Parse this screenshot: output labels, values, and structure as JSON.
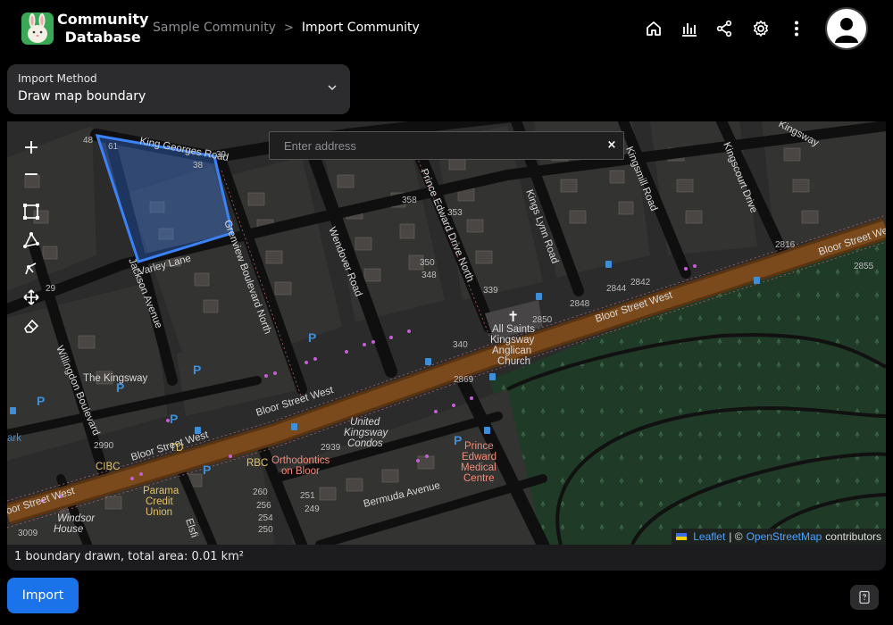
{
  "app": {
    "name_line1": "Community",
    "name_line2": "Database"
  },
  "breadcrumb": {
    "parent": "Sample Community",
    "separator": ">",
    "current": "Import Community"
  },
  "header_icons": [
    "home-icon",
    "chart-icon",
    "share-icon",
    "settings-icon",
    "more-vert-icon"
  ],
  "import_method": {
    "label": "Import Method",
    "value": "Draw map boundary"
  },
  "map": {
    "search_placeholder": "Enter address",
    "clear": "×",
    "zoom_in": "+",
    "zoom_out": "−",
    "tools": [
      "draw-rectangle-icon",
      "draw-polygon-icon",
      "edit-shape-icon",
      "drag-icon",
      "erase-icon"
    ],
    "attribution": {
      "leaflet": "Leaflet",
      "sep": " | © ",
      "osm": "OpenStreetMap",
      "suffix": " contributors"
    },
    "labels": {
      "king_georges": "King Georges Road",
      "bloor_1": "Bloor Street West",
      "bloor_2": "Bloor Street West",
      "bloor_3": "Bloor Street West",
      "bloor_4": "Bloor Street West",
      "bloor_5": "oor Street West",
      "pedw": "Prince Edward Drive North",
      "kingsway": "The Kingsway",
      "kingsway_top": "Kingsway",
      "jackson": "Jackson Avenue",
      "wendover": "Wendover Road",
      "kingsmill": "Kingsmill Road",
      "kings_lynn": "Kings Lynn Road",
      "kingscourt": "Kingscourt Drive",
      "willingdon": "Willingdon Boulevard",
      "varley": "Varley Lane",
      "grenview": "Grenview Boulevard North",
      "bermuda": "Bermuda Avenue",
      "elsfield": "Elsfi",
      "church_1": "All Saints",
      "church_2": "Kingsway",
      "church_3": "Anglican",
      "church_4": "Church",
      "ucc_1": "United",
      "ucc_2": "Kingsway",
      "ucc_3": "Condos",
      "ortho_1": "Orthodontics",
      "ortho_2": "on Bloor",
      "pemc_1": "Prince",
      "pemc_2": "Edward",
      "pemc_3": "Medical",
      "pemc_4": "Centre",
      "td": "TD",
      "rbc": "RBC",
      "cibc": "CIBC",
      "parama_1": "Parama",
      "parama_2": "Credit",
      "parama_3": "Union",
      "windsor_1": "Windsor",
      "windsor_2": "House",
      "ark": "ark",
      "n2850": "2850",
      "n2848": "2848",
      "n2844": "2844",
      "n2842": "2842",
      "n2855": "2855",
      "n2816": "2816",
      "n2869": "2869",
      "n2990": "2990",
      "n2939": "2939",
      "n3009": "3009",
      "n339": "339",
      "n340": "340",
      "n348": "348",
      "n350": "350",
      "n353": "353",
      "n358": "358",
      "n38": "38",
      "n39": "39",
      "n61": "61",
      "n48": "48",
      "n29": "29",
      "n260": "260",
      "n256": "256",
      "n254": "254",
      "n251": "251",
      "n250": "250",
      "n249": "249"
    }
  },
  "status_text": "1 boundary drawn, total area: 0.01 km²",
  "import_button": "Import",
  "colors": {
    "accent": "#1a73e8",
    "boundary": "#3b82f6",
    "park": "#1f3a27",
    "bloor": "#6b3e15"
  }
}
